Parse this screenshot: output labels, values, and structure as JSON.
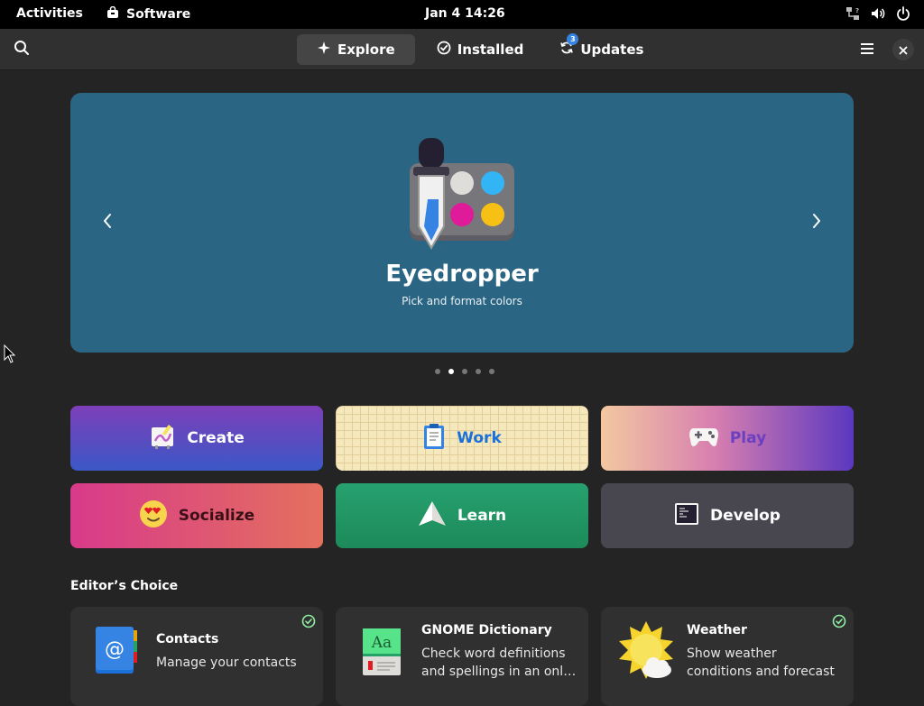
{
  "topbar": {
    "activities": "Activities",
    "app_name": "Software",
    "clock": "Jan 4  14:26"
  },
  "header": {
    "tabs": [
      {
        "label": "Explore",
        "icon": "sparkle-icon",
        "active": true
      },
      {
        "label": "Installed",
        "icon": "check-circle-icon",
        "active": false
      },
      {
        "label": "Updates",
        "icon": "refresh-icon",
        "active": false,
        "badge": "3"
      }
    ]
  },
  "featured": {
    "title": "Eyedropper",
    "subtitle": "Pick and format colors",
    "slide_count": 5,
    "active_slide": 2,
    "background": "#2a6684"
  },
  "categories": [
    {
      "label": "Create",
      "icon": "create-icon"
    },
    {
      "label": "Work",
      "icon": "clipboard-icon"
    },
    {
      "label": "Play",
      "icon": "gamepad-icon"
    },
    {
      "label": "Socialize",
      "icon": "heart-eyes-emoji-icon"
    },
    {
      "label": "Learn",
      "icon": "paper-plane-icon"
    },
    {
      "label": "Develop",
      "icon": "terminal-icon"
    }
  ],
  "editors_choice": {
    "title": "Editor’s Choice",
    "apps": [
      {
        "name": "Contacts",
        "description": "Manage your contacts",
        "installed": true,
        "icon": "contacts-icon"
      },
      {
        "name": "GNOME Dictionary",
        "description": "Check word definitions and spellings in an onl…",
        "installed": false,
        "icon": "dictionary-icon"
      },
      {
        "name": "Weather",
        "description": "Show weather conditions and forecast",
        "installed": true,
        "icon": "weather-icon"
      }
    ]
  },
  "dictionary_icon_text": "Aa",
  "contacts_icon_text": "@"
}
